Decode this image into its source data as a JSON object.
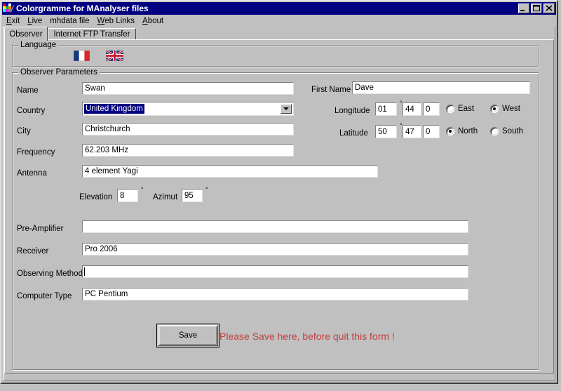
{
  "window": {
    "title": "Colorgramme for MAnalyser files",
    "icon": "app-colorgrid-icon",
    "buttons": {
      "minimize": "minimize-icon",
      "maximize": "maximize-icon",
      "close": "close-icon"
    }
  },
  "menubar": {
    "items": [
      {
        "label": "Exit",
        "accel": "E"
      },
      {
        "label": "Live",
        "accel": "L"
      },
      {
        "label": "mhdata file",
        "accel": ""
      },
      {
        "label": "Web Links",
        "accel": "W"
      },
      {
        "label": "About",
        "accel": "A"
      }
    ]
  },
  "tabs": [
    {
      "label": "Observer",
      "active": true
    },
    {
      "label": "Internet FTP Transfer",
      "active": false
    }
  ],
  "language": {
    "group_title": "Language",
    "options": [
      {
        "name": "french-flag",
        "label": "French"
      },
      {
        "name": "uk-flag",
        "label": "English"
      }
    ]
  },
  "observer": {
    "group_title": "Observer Parameters",
    "labels": {
      "name": "Name",
      "country": "Country",
      "city": "City",
      "frequency": "Frequency",
      "antenna": "Antenna",
      "elevation": "Elevation",
      "azimut": "Azimut",
      "preamp": "Pre-Amplifier",
      "receiver": "Receiver",
      "observing_method": "Observing Method",
      "computer_type": "Computer Type",
      "first_name": "First Name",
      "longitude": "Longitude",
      "latitude": "Latitude"
    },
    "values": {
      "name": "Swan",
      "country": "United Kingdom",
      "city": "Christchurch",
      "frequency": "62.203 MHz",
      "antenna": "4 element Yagi",
      "elevation": "8",
      "azimut": "95",
      "preamp": "",
      "receiver": "Pro 2006",
      "observing_method": "",
      "computer_type": "PC Pentium",
      "first_name": "Dave"
    },
    "longitude": {
      "deg": "01",
      "min": "44",
      "sec": "0",
      "east_label": "East",
      "west_label": "West",
      "selected": "West"
    },
    "latitude": {
      "deg": "50",
      "min": "47",
      "sec": "0",
      "north_label": "North",
      "south_label": "South",
      "selected": "North"
    },
    "degree_symbol": "°"
  },
  "actions": {
    "save_label": "Save",
    "warning": "Please Save here, before quit this form !",
    "warning_color": "#c04040"
  },
  "theme": {
    "face": "#c0c0c0",
    "titlebar": "#000080",
    "highlight": "#000080",
    "field_bg": "#ffffff"
  }
}
